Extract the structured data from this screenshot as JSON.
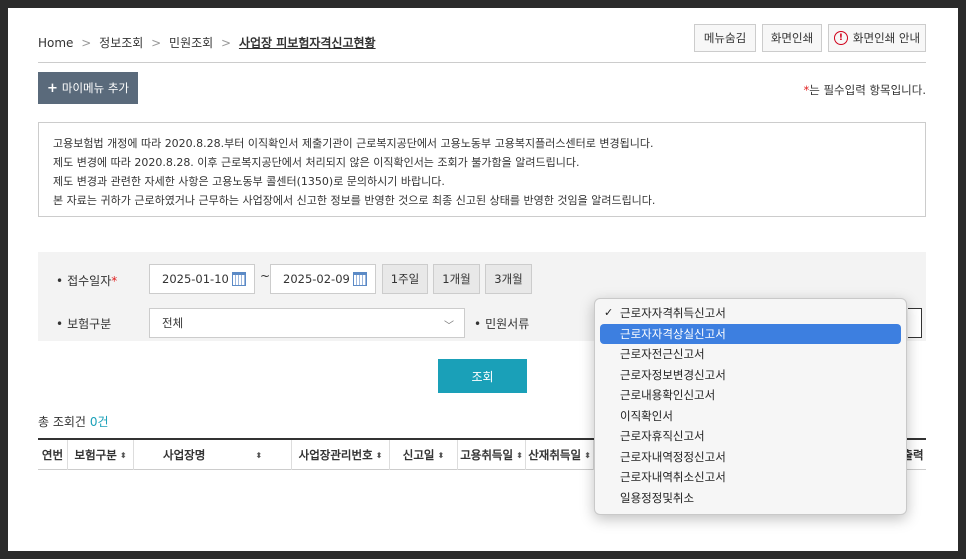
{
  "breadcrumb": {
    "home": "Home",
    "level1": "정보조회",
    "level2": "민원조회",
    "current": "사업장 피보험자격신고현황",
    "separator": ">"
  },
  "top_buttons": {
    "hide_menu": "메뉴숨김",
    "print_screen": "화면인쇄",
    "print_guide": "화면인쇄 안내"
  },
  "my_menu_button": "마이메뉴 추가",
  "required_note": {
    "asterisk": "*",
    "text": "는 필수입력 항목입니다."
  },
  "notice_lines": [
    "고용보험법 개정에 따라 2020.8.28.부터 이직확인서 제출기관이 근로복지공단에서 고용노동부 고용복지플러스센터로 변경됩니다.",
    "제도 변경에 따라 2020.8.28. 이후 근로복지공단에서 처리되지 않은 이직확인서는 조회가 불가함을 알려드립니다.",
    "제도 변경과 관련한 자세한 사항은 고용노동부 콜센터(1350)로 문의하시기 바랍니다.",
    "본 자료는 귀하가 근로하였거나 근무하는 사업장에서 신고한 정보를 반영한 것으로 최종 신고된 상태를 반영한 것임을 알려드립니다."
  ],
  "search": {
    "receipt_date_label": "접수일자",
    "receipt_date_required": "*",
    "date_from": "2025-01-10",
    "date_to": "2025-02-09",
    "tilde": "~",
    "period_buttons": [
      "1주일",
      "1개월",
      "3개월"
    ],
    "insurance_type_label": "보험구분",
    "insurance_type_value": "전체",
    "document_label": "민원서류",
    "search_button": "조회"
  },
  "result": {
    "total_label": "총 조회건",
    "total_count": "0건"
  },
  "table_headers": [
    "연번",
    "보험구분",
    "사업장명",
    "사업장관리번호",
    "신고일",
    "고용취득일",
    "산재취득일",
    "출력"
  ],
  "dropdown": {
    "options": [
      "근로자자격취득신고서",
      "근로자자격상실신고서",
      "근로자전근신고서",
      "근로자정보변경신고서",
      "근로내용확인신고서",
      "이직확인서",
      "근로자휴직신고서",
      "근로자내역정정신고서",
      "근로자내역취소신고서",
      "일용정정및취소"
    ],
    "selected_index": 0,
    "highlighted_index": 1,
    "check_mark": "✓"
  },
  "colors": {
    "accent": "#1aa0b8",
    "my_menu_bg": "#5a6a7b",
    "required": "#e02020",
    "highlight": "#3d7fe0"
  }
}
